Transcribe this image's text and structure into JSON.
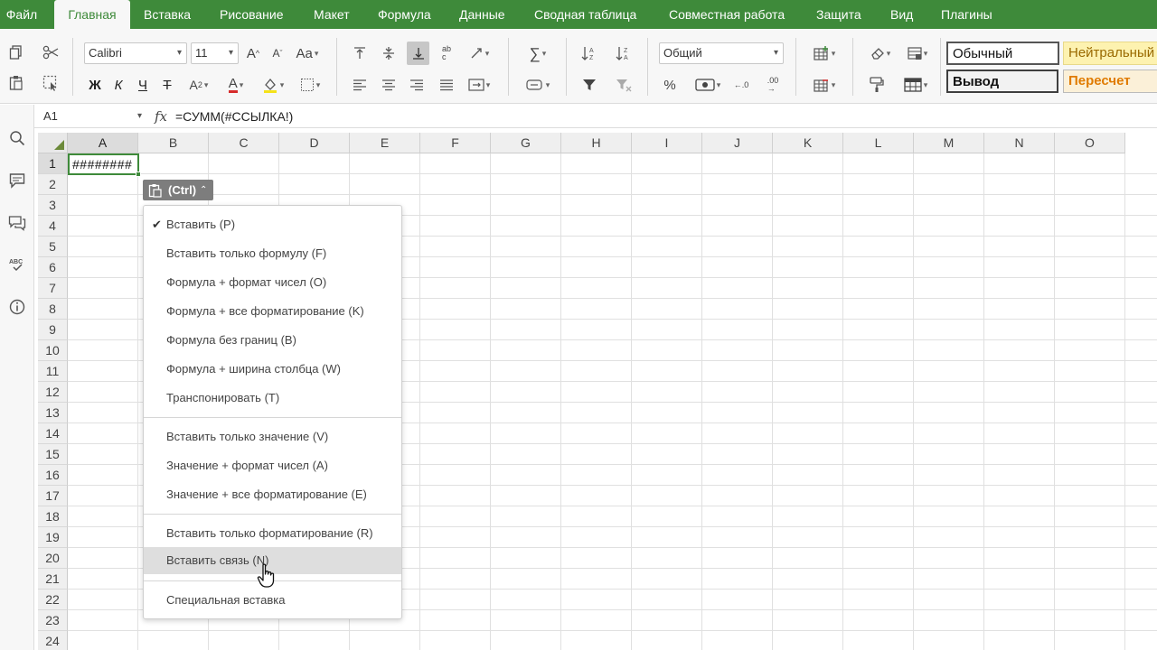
{
  "menubar": {
    "tabs": [
      {
        "label": "Файл",
        "active": false
      },
      {
        "label": "Главная",
        "active": true
      },
      {
        "label": "Вставка",
        "active": false
      },
      {
        "label": "Рисование",
        "active": false
      },
      {
        "label": "Макет",
        "active": false
      },
      {
        "label": "Формула",
        "active": false
      },
      {
        "label": "Данные",
        "active": false
      },
      {
        "label": "Сводная таблица",
        "active": false
      },
      {
        "label": "Совместная работа",
        "active": false
      },
      {
        "label": "Защита",
        "active": false
      },
      {
        "label": "Вид",
        "active": false
      },
      {
        "label": "Плагины",
        "active": false
      }
    ]
  },
  "ribbon": {
    "font_name": "Calibri",
    "font_size": "11",
    "bold_label": "Ж",
    "italic_label": "К",
    "underline_label": "Ч",
    "strike_label": "Т",
    "number_format": "Общий",
    "styles": [
      {
        "label": "Обычный"
      },
      {
        "label": "Нейтральный"
      },
      {
        "label": "Вывод"
      },
      {
        "label": "Пересчет"
      }
    ]
  },
  "formula_bar": {
    "name_box": "A1",
    "fx_label": "fx",
    "formula": "=СУММ(#ССЫЛКА!)"
  },
  "grid": {
    "columns": [
      "A",
      "B",
      "C",
      "D",
      "E",
      "F",
      "G",
      "H",
      "I",
      "J",
      "K",
      "L",
      "M",
      "N",
      "O"
    ],
    "rows": [
      "1",
      "2",
      "3",
      "4",
      "5",
      "6",
      "7",
      "8",
      "9",
      "10",
      "11",
      "12",
      "13",
      "14",
      "15",
      "16",
      "17",
      "18",
      "19",
      "20",
      "21",
      "22",
      "23",
      "24"
    ],
    "active_cell_value": "########"
  },
  "paste_button": {
    "label": "(Ctrl)"
  },
  "paste_menu": {
    "items": [
      {
        "label": "Вставить (P)",
        "checked": true
      },
      {
        "label": "Вставить только формулу (F)"
      },
      {
        "label": "Формула + формат чисел (O)"
      },
      {
        "label": "Формула + все форматирование (K)"
      },
      {
        "label": "Формула без границ (B)"
      },
      {
        "label": "Формула + ширина столбца (W)"
      },
      {
        "label": "Транспонировать (T)"
      },
      {
        "label": "Вставить только значение (V)"
      },
      {
        "label": "Значение + формат чисел (A)"
      },
      {
        "label": "Значение + все форматирование (E)"
      },
      {
        "label": "Вставить только форматирование (R)"
      },
      {
        "label": "Вставить связь (N)",
        "highlighted": true
      },
      {
        "label": "Специальная вставка"
      }
    ]
  },
  "colors": {
    "accent": "#3e8a3a",
    "neutral_style_bg": "#fdf2b0",
    "neutral_style_text": "#9a6a00",
    "recalc_style_bg": "#fbf0d8",
    "recalc_style_text": "#e07b00"
  }
}
